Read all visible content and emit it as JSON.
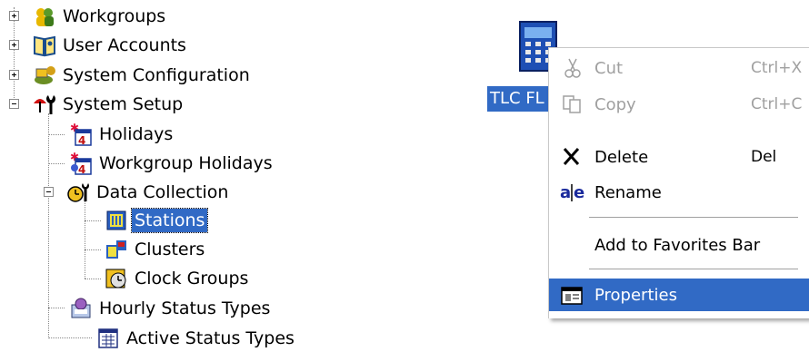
{
  "tree": {
    "items": [
      {
        "label": "Workgroups"
      },
      {
        "label": "User Accounts"
      },
      {
        "label": "System Configuration"
      },
      {
        "label": "System Setup"
      },
      {
        "label": "Holidays"
      },
      {
        "label": "Workgroup Holidays"
      },
      {
        "label": "Data Collection"
      },
      {
        "label": "Stations",
        "selected": true
      },
      {
        "label": "Clusters"
      },
      {
        "label": "Clock Groups"
      },
      {
        "label": "Hourly Status Types"
      },
      {
        "label": "Active Status Types"
      }
    ]
  },
  "desktop_icon": {
    "label": "TLC FL"
  },
  "context_menu": {
    "items": [
      {
        "label": "Cut",
        "shortcut": "Ctrl+X",
        "enabled": false,
        "icon": "scissors-icon"
      },
      {
        "label": "Copy",
        "shortcut": "Ctrl+C",
        "enabled": false,
        "icon": "copy-icon"
      },
      {
        "label": "Delete",
        "shortcut": "Del",
        "enabled": true,
        "icon": "delete-x-icon"
      },
      {
        "label": "Rename",
        "shortcut": "",
        "enabled": true,
        "icon": "rename-icon"
      },
      {
        "label": "Add to Favorites Bar",
        "shortcut": "",
        "enabled": true,
        "icon": ""
      },
      {
        "label": "Properties",
        "shortcut": "",
        "enabled": true,
        "highlighted": true,
        "icon": "properties-icon"
      }
    ]
  },
  "colors": {
    "selection": "#316ac5",
    "disabled_text": "#a0a0a0"
  }
}
